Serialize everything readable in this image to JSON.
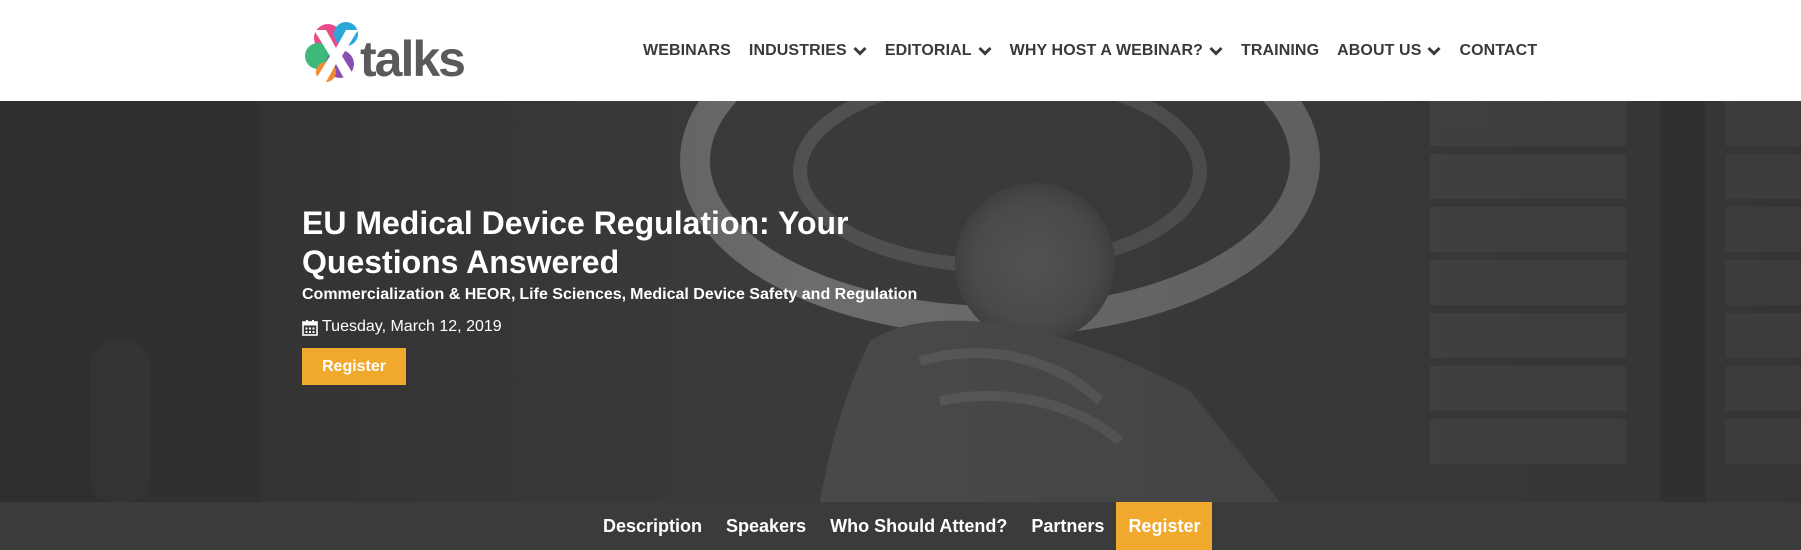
{
  "brand": {
    "logo_text": "talks",
    "logo_icon": "xtalks-x-logo",
    "accent_color": "#f0a92d"
  },
  "nav": {
    "items": [
      {
        "label": "WEBINARS",
        "dropdown": false
      },
      {
        "label": "INDUSTRIES",
        "dropdown": true
      },
      {
        "label": "EDITORIAL",
        "dropdown": true
      },
      {
        "label": "WHY HOST A WEBINAR?",
        "dropdown": true
      },
      {
        "label": "TRAINING",
        "dropdown": false
      },
      {
        "label": "ABOUT US",
        "dropdown": true
      },
      {
        "label": "CONTACT",
        "dropdown": false
      }
    ]
  },
  "hero": {
    "title": "EU Medical Device Regulation: Your Questions Answered",
    "categories": [
      "Commercialization & HEOR",
      "Life Sciences",
      "Medical Device Safety and Regulation"
    ],
    "category_separator": ",",
    "date_icon": "calendar-icon",
    "date": "Tuesday, March 12, 2019",
    "register_label": "Register"
  },
  "subnav": {
    "items": [
      {
        "label": "Description",
        "active": false
      },
      {
        "label": "Speakers",
        "active": false
      },
      {
        "label": "Who Should Attend?",
        "active": false
      },
      {
        "label": "Partners",
        "active": false
      },
      {
        "label": "Register",
        "active": true
      }
    ]
  }
}
